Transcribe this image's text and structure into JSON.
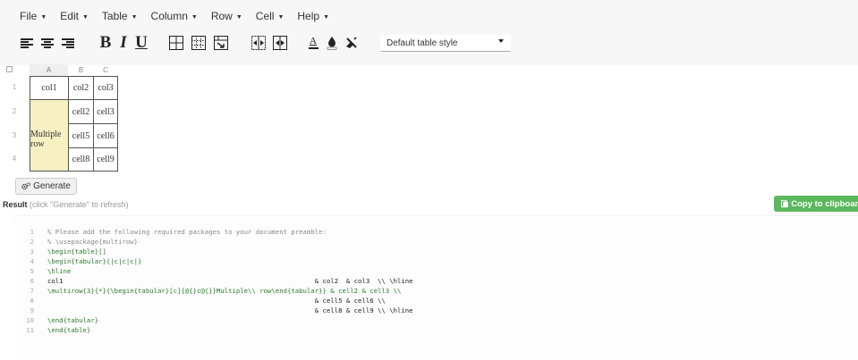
{
  "menubar": {
    "items": [
      {
        "label": "File"
      },
      {
        "label": "Edit"
      },
      {
        "label": "Table"
      },
      {
        "label": "Column"
      },
      {
        "label": "Row"
      },
      {
        "label": "Cell"
      },
      {
        "label": "Help"
      }
    ],
    "caret": "▼"
  },
  "toolbar": {
    "bold": "B",
    "italic": "I",
    "underline": "U",
    "text_color_glyph": "A",
    "table_style": {
      "selected": "Default table style"
    }
  },
  "grid": {
    "col_headers": [
      "A",
      "B",
      "C"
    ],
    "row_headers": [
      "1",
      "2",
      "3",
      "4"
    ],
    "cells": {
      "r1c1": "col1",
      "r1c2": "col2",
      "r1c3": "col3",
      "merged_a2_line1": "Multiple",
      "merged_a2_line2": "row",
      "r2c2": "cell2",
      "r2c3": "cell3",
      "r3c2": "cell5",
      "r3c3": "cell6",
      "r4c2": "cell8",
      "r4c3": "cell9"
    },
    "merged_color": "#f6f0c2"
  },
  "generate": {
    "label": "Generate"
  },
  "result": {
    "label": "Result",
    "hint": "(click \"Generate\" to refresh)"
  },
  "copy": {
    "label": "Copy to clipboard",
    "color": "#5cb85c"
  },
  "code": {
    "lines": [
      {
        "n": "1",
        "text": "% Please add the following required packages to your document preamble:"
      },
      {
        "n": "2",
        "text": "% \\usepackage{multirow}"
      },
      {
        "n": "3",
        "text": "\\begin{table}[]"
      },
      {
        "n": "4",
        "text": "\\begin{tabular}{|c|c|c|}"
      },
      {
        "n": "5",
        "text": "\\hline"
      },
      {
        "n": "6",
        "text": "col1                                                                & col2  & col3  \\\\ \\hline"
      },
      {
        "n": "7",
        "text": "\\multirow{3}{*}{\\begin{tabular}[c]{@{}c@{}}Multiple\\\\ row\\end{tabular}} & cell2 & cell3 \\\\"
      },
      {
        "n": "8",
        "text": "                                                                    & cell5 & cell6 \\\\"
      },
      {
        "n": "9",
        "text": "                                                                    & cell8 & cell9 \\\\ \\hline"
      },
      {
        "n": "10",
        "text": "\\end{tabular}"
      },
      {
        "n": "11",
        "text": "\\end{table}"
      }
    ]
  }
}
